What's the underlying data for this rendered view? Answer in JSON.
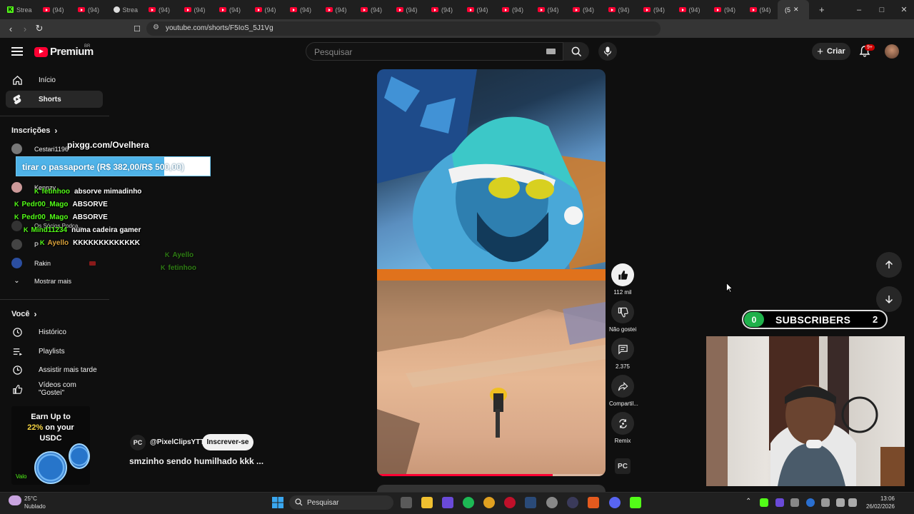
{
  "browser": {
    "tabs": [
      {
        "label": "Strea",
        "icon": "kick-icon"
      },
      {
        "label": "(94)",
        "icon": "youtube-icon"
      },
      {
        "label": "(94)",
        "icon": "youtube-icon"
      },
      {
        "label": "Strea",
        "icon": "steam-icon"
      },
      {
        "label": "(94)",
        "icon": "youtube-icon"
      },
      {
        "label": "(94)",
        "icon": "youtube-icon"
      },
      {
        "label": "(94)",
        "icon": "youtube-icon"
      },
      {
        "label": "(94)",
        "icon": "youtube-icon"
      },
      {
        "label": "(94)",
        "icon": "youtube-icon"
      },
      {
        "label": "(94)",
        "icon": "youtube-icon"
      },
      {
        "label": "(94)",
        "icon": "youtube-icon"
      },
      {
        "label": "(94)",
        "icon": "youtube-icon"
      },
      {
        "label": "(94)",
        "icon": "youtube-icon"
      },
      {
        "label": "(94)",
        "icon": "youtube-icon"
      },
      {
        "label": "(94)",
        "icon": "youtube-icon"
      },
      {
        "label": "(94)",
        "icon": "youtube-icon"
      },
      {
        "label": "(94)",
        "icon": "youtube-icon"
      },
      {
        "label": "(94)",
        "icon": "youtube-icon"
      },
      {
        "label": "(94)",
        "icon": "youtube-icon"
      },
      {
        "label": "(94)",
        "icon": "youtube-icon"
      },
      {
        "label": "(94)",
        "icon": "youtube-icon"
      },
      {
        "label": "(94)",
        "icon": "youtube-icon"
      }
    ],
    "active_tab": "(5",
    "url": "youtube.com/shorts/F5IoS_5J1Vg"
  },
  "header": {
    "logo": "Premium",
    "logo_region": "BR",
    "search_placeholder": "Pesquisar",
    "create_label": "Criar",
    "notifications": "9+"
  },
  "sidebar": {
    "nav": [
      {
        "label": "Início",
        "icon": "home-icon"
      },
      {
        "label": "Shorts",
        "icon": "shorts-icon",
        "active": true
      }
    ],
    "subs_heading": "Inscrições",
    "subscriptions": [
      "Cestari1196",
      "",
      "Kennzy",
      "",
      "Os Sócios Podca...",
      "P",
      "Rakin"
    ],
    "show_more": "Mostrar mais",
    "you_heading": "Você",
    "you_items": [
      {
        "label": "Histórico",
        "icon": "history-icon"
      },
      {
        "label": "Playlists",
        "icon": "playlists-icon"
      },
      {
        "label": "Assistir mais tarde",
        "icon": "watch-later-icon"
      },
      {
        "label": "Vídeos com \"Gostei\"",
        "icon": "thumbs-up-icon"
      }
    ]
  },
  "overlay": {
    "pix": "pixgg.com/Ovelhera",
    "goal_text": "tirar o passaporte (R$ 382,00/R$ 500,00)",
    "goal_progress": 0.764,
    "chat": [
      {
        "user": "fetinhoo",
        "msg": "absorve mimadinho"
      },
      {
        "user": "Pedr00_Mago",
        "msg": "ABSORVE"
      },
      {
        "user": "Pedr00_Mago",
        "msg": "ABSORVE"
      },
      {
        "user": "Mind11234",
        "msg": "numa cadeira gamer"
      },
      {
        "user": "Ayello",
        "msg": "KKKKKKKKKKKKK"
      },
      {
        "user": "Ayello",
        "msg": ""
      },
      {
        "user": "fetinhoo",
        "msg": ""
      }
    ]
  },
  "ad": {
    "line1": "Earn Up to",
    "line2_accent": "22%",
    "line2_rest": " on your",
    "line3": "USDC",
    "footer": "Valo"
  },
  "short": {
    "channel_handle": "@PixelClipsYTT",
    "channel_badge": "PC",
    "subscribe_label": "Inscrever-se",
    "title": "smzinho sendo humilhado kkk ...",
    "progress": 0.77,
    "likes": "112 mil",
    "dislike_label": "Não gostei",
    "comments": "2.375",
    "share_label": "Compartil...",
    "remix_label": "Remix"
  },
  "widget": {
    "left_count": "0",
    "label": "SUBSCRIBERS",
    "right_count": "2",
    "left_color": "#1fb14b"
  },
  "taskbar": {
    "temp": "25°C",
    "weather": "Nublado",
    "search": "Pesquisar",
    "time": "13:06",
    "date": "26/02/2026"
  },
  "colors": {
    "youtube_red": "#ff0033",
    "kick_green": "#53fc18",
    "background": "#0f0f0f"
  }
}
